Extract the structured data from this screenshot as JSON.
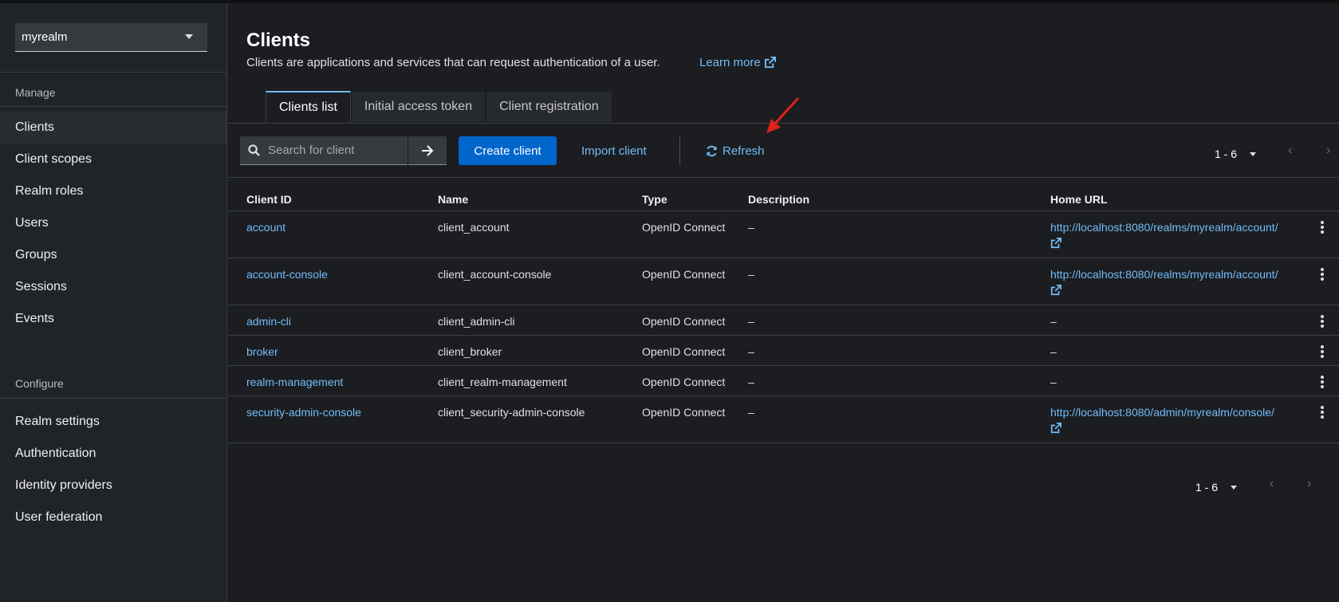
{
  "realm_selector": {
    "value": "myrealm"
  },
  "sidebar": {
    "manage_label": "Manage",
    "manage_items": [
      "Clients",
      "Client scopes",
      "Realm roles",
      "Users",
      "Groups",
      "Sessions",
      "Events"
    ],
    "configure_label": "Configure",
    "configure_items": [
      "Realm settings",
      "Authentication",
      "Identity providers",
      "User federation"
    ]
  },
  "header": {
    "title": "Clients",
    "description": "Clients are applications and services that can request authentication of a user.",
    "learn_more": "Learn more"
  },
  "tabs": [
    "Clients list",
    "Initial access token",
    "Client registration"
  ],
  "toolbar": {
    "search_placeholder": "Search for client",
    "create_label": "Create client",
    "import_label": "Import client",
    "refresh_label": "Refresh",
    "pagination": "1 - 6"
  },
  "table": {
    "columns": [
      "Client ID",
      "Name",
      "Type",
      "Description",
      "Home URL"
    ],
    "rows": [
      {
        "client_id": "account",
        "name": "client_account",
        "type": "OpenID Connect",
        "description": "–",
        "home_url": "http://localhost:8080/realms/myrealm/account/"
      },
      {
        "client_id": "account-console",
        "name": "client_account-console",
        "type": "OpenID Connect",
        "description": "–",
        "home_url": "http://localhost:8080/realms/myrealm/account/"
      },
      {
        "client_id": "admin-cli",
        "name": "client_admin-cli",
        "type": "OpenID Connect",
        "description": "–",
        "home_url": "–"
      },
      {
        "client_id": "broker",
        "name": "client_broker",
        "type": "OpenID Connect",
        "description": "–",
        "home_url": "–"
      },
      {
        "client_id": "realm-management",
        "name": "client_realm-management",
        "type": "OpenID Connect",
        "description": "–",
        "home_url": "–"
      },
      {
        "client_id": "security-admin-console",
        "name": "client_security-admin-console",
        "type": "OpenID Connect",
        "description": "–",
        "home_url": "http://localhost:8080/admin/myrealm/console/"
      }
    ]
  },
  "footer_pagination": "1 - 6",
  "colors": {
    "accent": "#0066cc",
    "link": "#73bcf7",
    "annotation_arrow": "#e0201b"
  },
  "icons": [
    "caret-down-icon",
    "external-link-icon",
    "search-icon",
    "arrow-right-icon",
    "refresh-icon",
    "kebab-icon",
    "angle-left-icon",
    "angle-right-icon"
  ]
}
